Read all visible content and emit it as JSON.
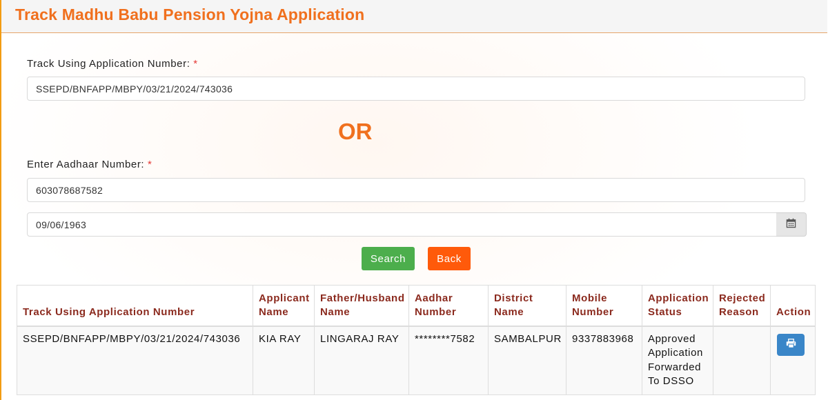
{
  "header": {
    "title": "Track Madhu Babu Pension Yojna Application"
  },
  "form": {
    "application_number_label": "Track Using Application Number:",
    "application_number_value": "SSEPD/BNFAPP/MBPY/03/21/2024/743036",
    "required_marker": "*",
    "or_text": "OR",
    "aadhaar_label": "Enter Aadhaar Number:",
    "aadhaar_value": "603078687582",
    "dob_value": "09/06/1963",
    "calendar_icon": "calendar-icon",
    "search_label": "Search",
    "back_label": "Back"
  },
  "colors": {
    "title": "#f0701e",
    "search_button": "#4cae4c",
    "back_button": "#ff5a0a",
    "table_header_text": "#8b2a1e",
    "print_button": "#3a86c8"
  },
  "table": {
    "headers": [
      "Track Using Application Number",
      "Applicant Name",
      "Father/Husband Name",
      "Aadhar Number",
      "District Name",
      "Mobile Number",
      "Application Status",
      "Rejected Reason",
      "Action"
    ],
    "rows": [
      {
        "application_number": "SSEPD/BNFAPP/MBPY/03/21/2024/743036",
        "applicant_name": "KIA RAY",
        "father_husband_name": "LINGARAJ RAY",
        "aadhar_number": "********7582",
        "district_name": "SAMBALPUR",
        "mobile_number": "9337883968",
        "application_status": "Approved Application Forwarded To DSSO",
        "rejected_reason": "",
        "action_icon": "print-icon"
      }
    ]
  }
}
